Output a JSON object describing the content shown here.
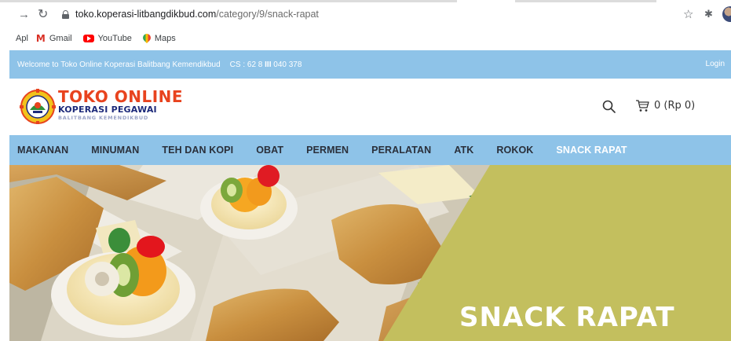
{
  "browser": {
    "url_host": "toko.koperasi-litbangdikbud.com",
    "url_path": "/category/9/snack-rapat",
    "forward_icon": "arrow-right-icon",
    "reload_icon": "reload-icon",
    "bookmarks": [
      {
        "label": "Apl"
      },
      {
        "label": "Gmail",
        "icon": "gmail-icon"
      },
      {
        "label": "YouTube",
        "icon": "youtube-icon"
      },
      {
        "label": "Maps",
        "icon": "maps-icon"
      }
    ]
  },
  "topbar": {
    "welcome": "Welcome to Toko Online Koperasi Balitbang Kemendikbud",
    "cs": "CS : 62 8 ",
    "cs_bold": "III",
    "cs_end": " 040 378",
    "login": "Login",
    "bg_color": "#8ec3e8"
  },
  "header": {
    "logo_line1": "TOKO ONLINE",
    "logo_line2": "KOPERASI PEGAWAI",
    "logo_line3": "BALITBANG KEMENDIKBUD",
    "cart_text": "0 (Rp 0)",
    "accent_color": "#e8431e"
  },
  "categories": [
    {
      "label": "MAKANAN",
      "active": false
    },
    {
      "label": "MINUMAN",
      "active": false
    },
    {
      "label": "TEH DAN KOPI",
      "active": false
    },
    {
      "label": "OBAT",
      "active": false
    },
    {
      "label": "PERMEN",
      "active": false
    },
    {
      "label": "PERALATAN",
      "active": false
    },
    {
      "label": "ATK",
      "active": false
    },
    {
      "label": "ROKOK",
      "active": false
    },
    {
      "label": "SNACK RAPAT",
      "active": true
    }
  ],
  "banner": {
    "title": "SNACK RAPAT",
    "panel_color": "#c3bf5e"
  }
}
